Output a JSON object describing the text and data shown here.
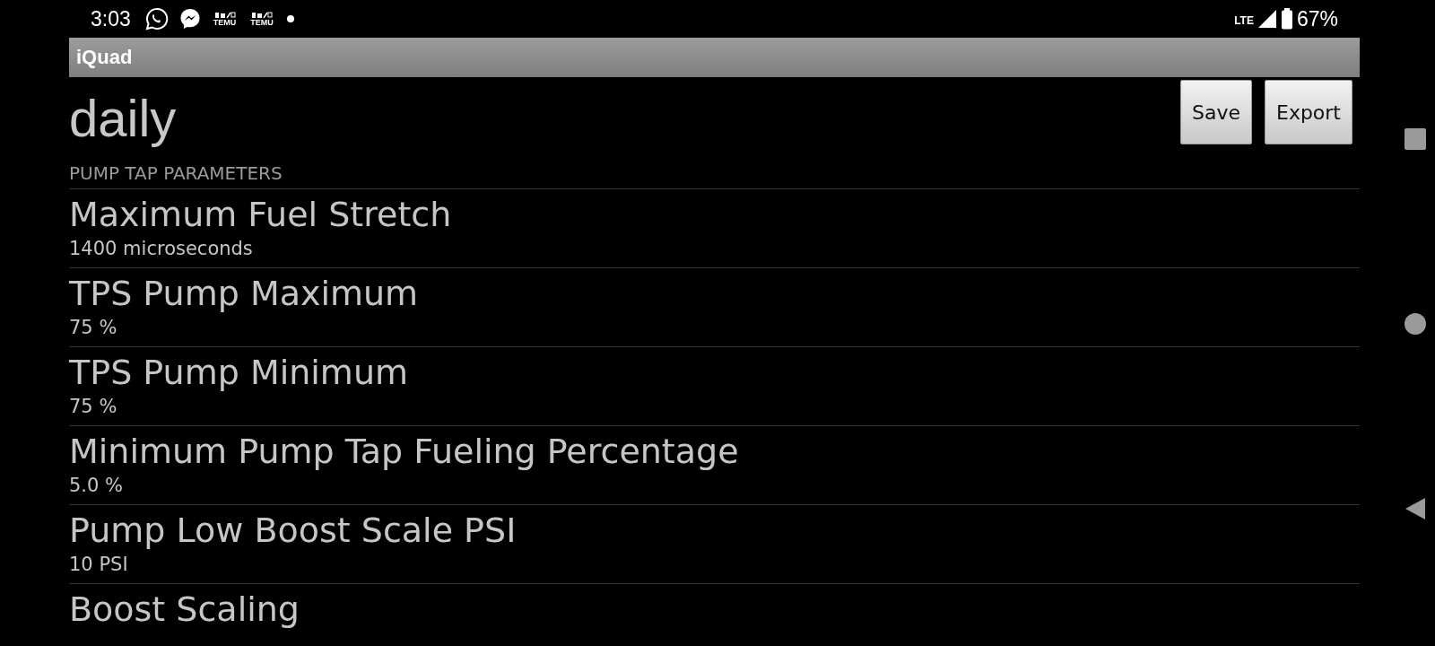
{
  "status_bar": {
    "time": "3:03",
    "notifications": [
      {
        "kind": "whatsapp"
      },
      {
        "kind": "messenger"
      },
      {
        "kind": "temu",
        "label": "TEMU"
      },
      {
        "kind": "temu",
        "label": "TEMU"
      },
      {
        "kind": "dot"
      }
    ],
    "network": "LTE",
    "battery": "67%"
  },
  "app_bar": {
    "title": "iQuad"
  },
  "header": {
    "title": "daily",
    "buttons": [
      "Save",
      "Export"
    ]
  },
  "section": {
    "title": "PUMP TAP PARAMETERS"
  },
  "settings": [
    {
      "title": "Maximum Fuel Stretch",
      "value": "1400 microseconds"
    },
    {
      "title": "TPS Pump Maximum",
      "value": "75 %"
    },
    {
      "title": "TPS Pump Minimum",
      "value": "75 %"
    },
    {
      "title": "Minimum Pump Tap Fueling Percentage",
      "value": "5.0 %"
    },
    {
      "title": "Pump Low Boost Scale PSI",
      "value": "10 PSI"
    },
    {
      "title": "Boost Scaling"
    }
  ],
  "nav_bar": [
    {
      "kind": "recents"
    },
    {
      "kind": "home"
    },
    {
      "kind": "back"
    }
  ]
}
